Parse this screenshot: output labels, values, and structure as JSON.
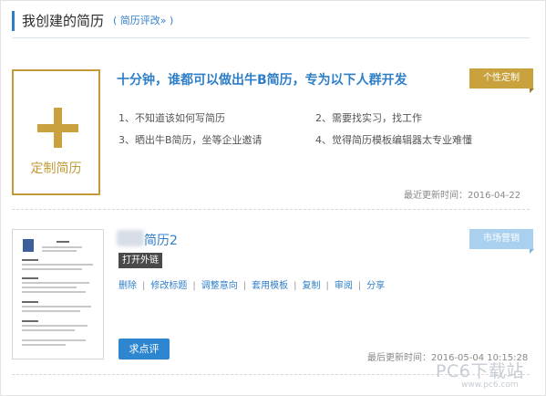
{
  "header": {
    "title": "我创建的简历",
    "link": "( 简历评改» )"
  },
  "custom_card": {
    "box_label": "定制简历",
    "title": "十分钟，谁都可以做出牛B简历，专为以下人群开发",
    "tag": "个性定制",
    "features": [
      "1、不知道该如何写简历",
      "2、需要找实习，找工作",
      "3、晒出牛B简历，坐等企业邀请",
      "4、觉得简历模板编辑器太专业难懂"
    ],
    "updated": "最近更新时间：2016-04-22",
    "colors": {
      "accent": "#c9a23e"
    }
  },
  "resume_card": {
    "title_suffix": "简历2",
    "open_link": "打开外链",
    "tag": "市场营销",
    "actions": [
      "删除",
      "修改标题",
      "调整意向",
      "套用模板",
      "复制",
      "审阅",
      "分享"
    ],
    "review_button": "求点评",
    "updated": "最后更新时间：2016-05-04 10:15:28",
    "colors": {
      "tag": "#a9d1ef",
      "button": "#2f86d0"
    }
  },
  "watermark": {
    "brand": "PC6下载站",
    "url": "www.pc6.com"
  }
}
